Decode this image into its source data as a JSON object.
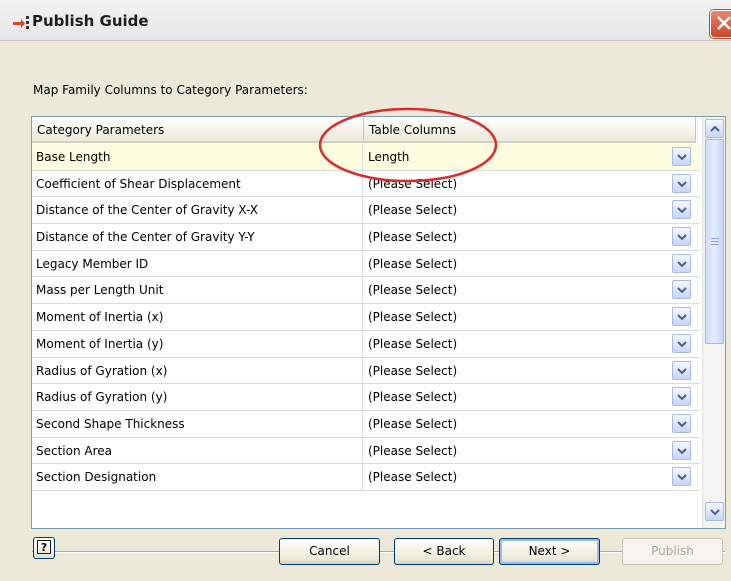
{
  "window": {
    "title": "Publish Guide",
    "app_icon": "publish-arrow-icon",
    "close_icon": "close-icon"
  },
  "instruction": "Map Family Columns to Category Parameters:",
  "grid": {
    "headers": [
      "Category Parameters",
      "Table Columns"
    ],
    "rows": [
      {
        "parameter": "Base Length",
        "column": "Length",
        "selected": true
      },
      {
        "parameter": "Coefficient of Shear Displacement",
        "column": "(Please Select)"
      },
      {
        "parameter": "Distance of the Center of Gravity X-X",
        "column": "(Please Select)"
      },
      {
        "parameter": "Distance of the Center of Gravity Y-Y",
        "column": "(Please Select)"
      },
      {
        "parameter": "Legacy Member ID",
        "column": "(Please Select)"
      },
      {
        "parameter": "Mass per Length Unit",
        "column": "(Please Select)"
      },
      {
        "parameter": "Moment of Inertia (x)",
        "column": "(Please Select)"
      },
      {
        "parameter": "Moment of Inertia (y)",
        "column": "(Please Select)"
      },
      {
        "parameter": "Radius of Gyration (x)",
        "column": "(Please Select)"
      },
      {
        "parameter": "Radius of Gyration (y)",
        "column": "(Please Select)"
      },
      {
        "parameter": "Second Shape Thickness",
        "column": "(Please Select)"
      },
      {
        "parameter": "Section Area",
        "column": "(Please Select)"
      },
      {
        "parameter": "Section Designation",
        "column": "(Please Select)"
      }
    ],
    "highlight_color": "#d92c2c"
  },
  "buttons": {
    "help": "?",
    "cancel": "Cancel",
    "back": "< Back",
    "next": "Next >",
    "publish": "Publish"
  }
}
